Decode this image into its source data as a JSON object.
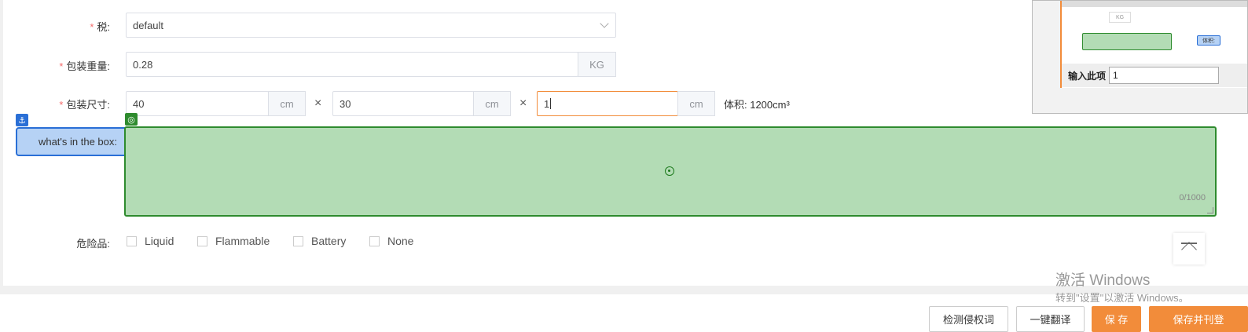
{
  "form": {
    "tax": {
      "label": "税:",
      "value": "default"
    },
    "weight": {
      "label": "包装重量:",
      "value": "0.28",
      "unit": "KG"
    },
    "dimensions": {
      "label": "包装尺寸:",
      "length": "40",
      "width": "30",
      "height": "1",
      "unit": "cm",
      "times": "×",
      "volume_label": "体积: 1200cm³"
    },
    "box": {
      "label": "what's in the box:",
      "counter": "0/1000"
    },
    "dangerous": {
      "label": "危险品:",
      "options": [
        "Liquid",
        "Flammable",
        "Battery",
        "None"
      ]
    }
  },
  "overlay": {
    "anchor_glyph": "⚓",
    "target_glyph": "◎",
    "mini_input_label": "输入此项",
    "mini_input_value": "1",
    "mini_kg": "KG",
    "mini_blue_label": "体积:"
  },
  "watermark": {
    "line1": "激活 Windows",
    "line2": "转到\"设置\"以激活 Windows。"
  },
  "footer": {
    "check_button": "检测侵权词",
    "translate_button": "一键翻译",
    "save_button": "保 存",
    "save_publish_button": "保存并刊登"
  },
  "colors": {
    "required": "#f56c6c",
    "accent_orange": "#f28c3a",
    "green_highlight": "#b3dcb5",
    "blue_highlight": "#b6d2f5"
  }
}
